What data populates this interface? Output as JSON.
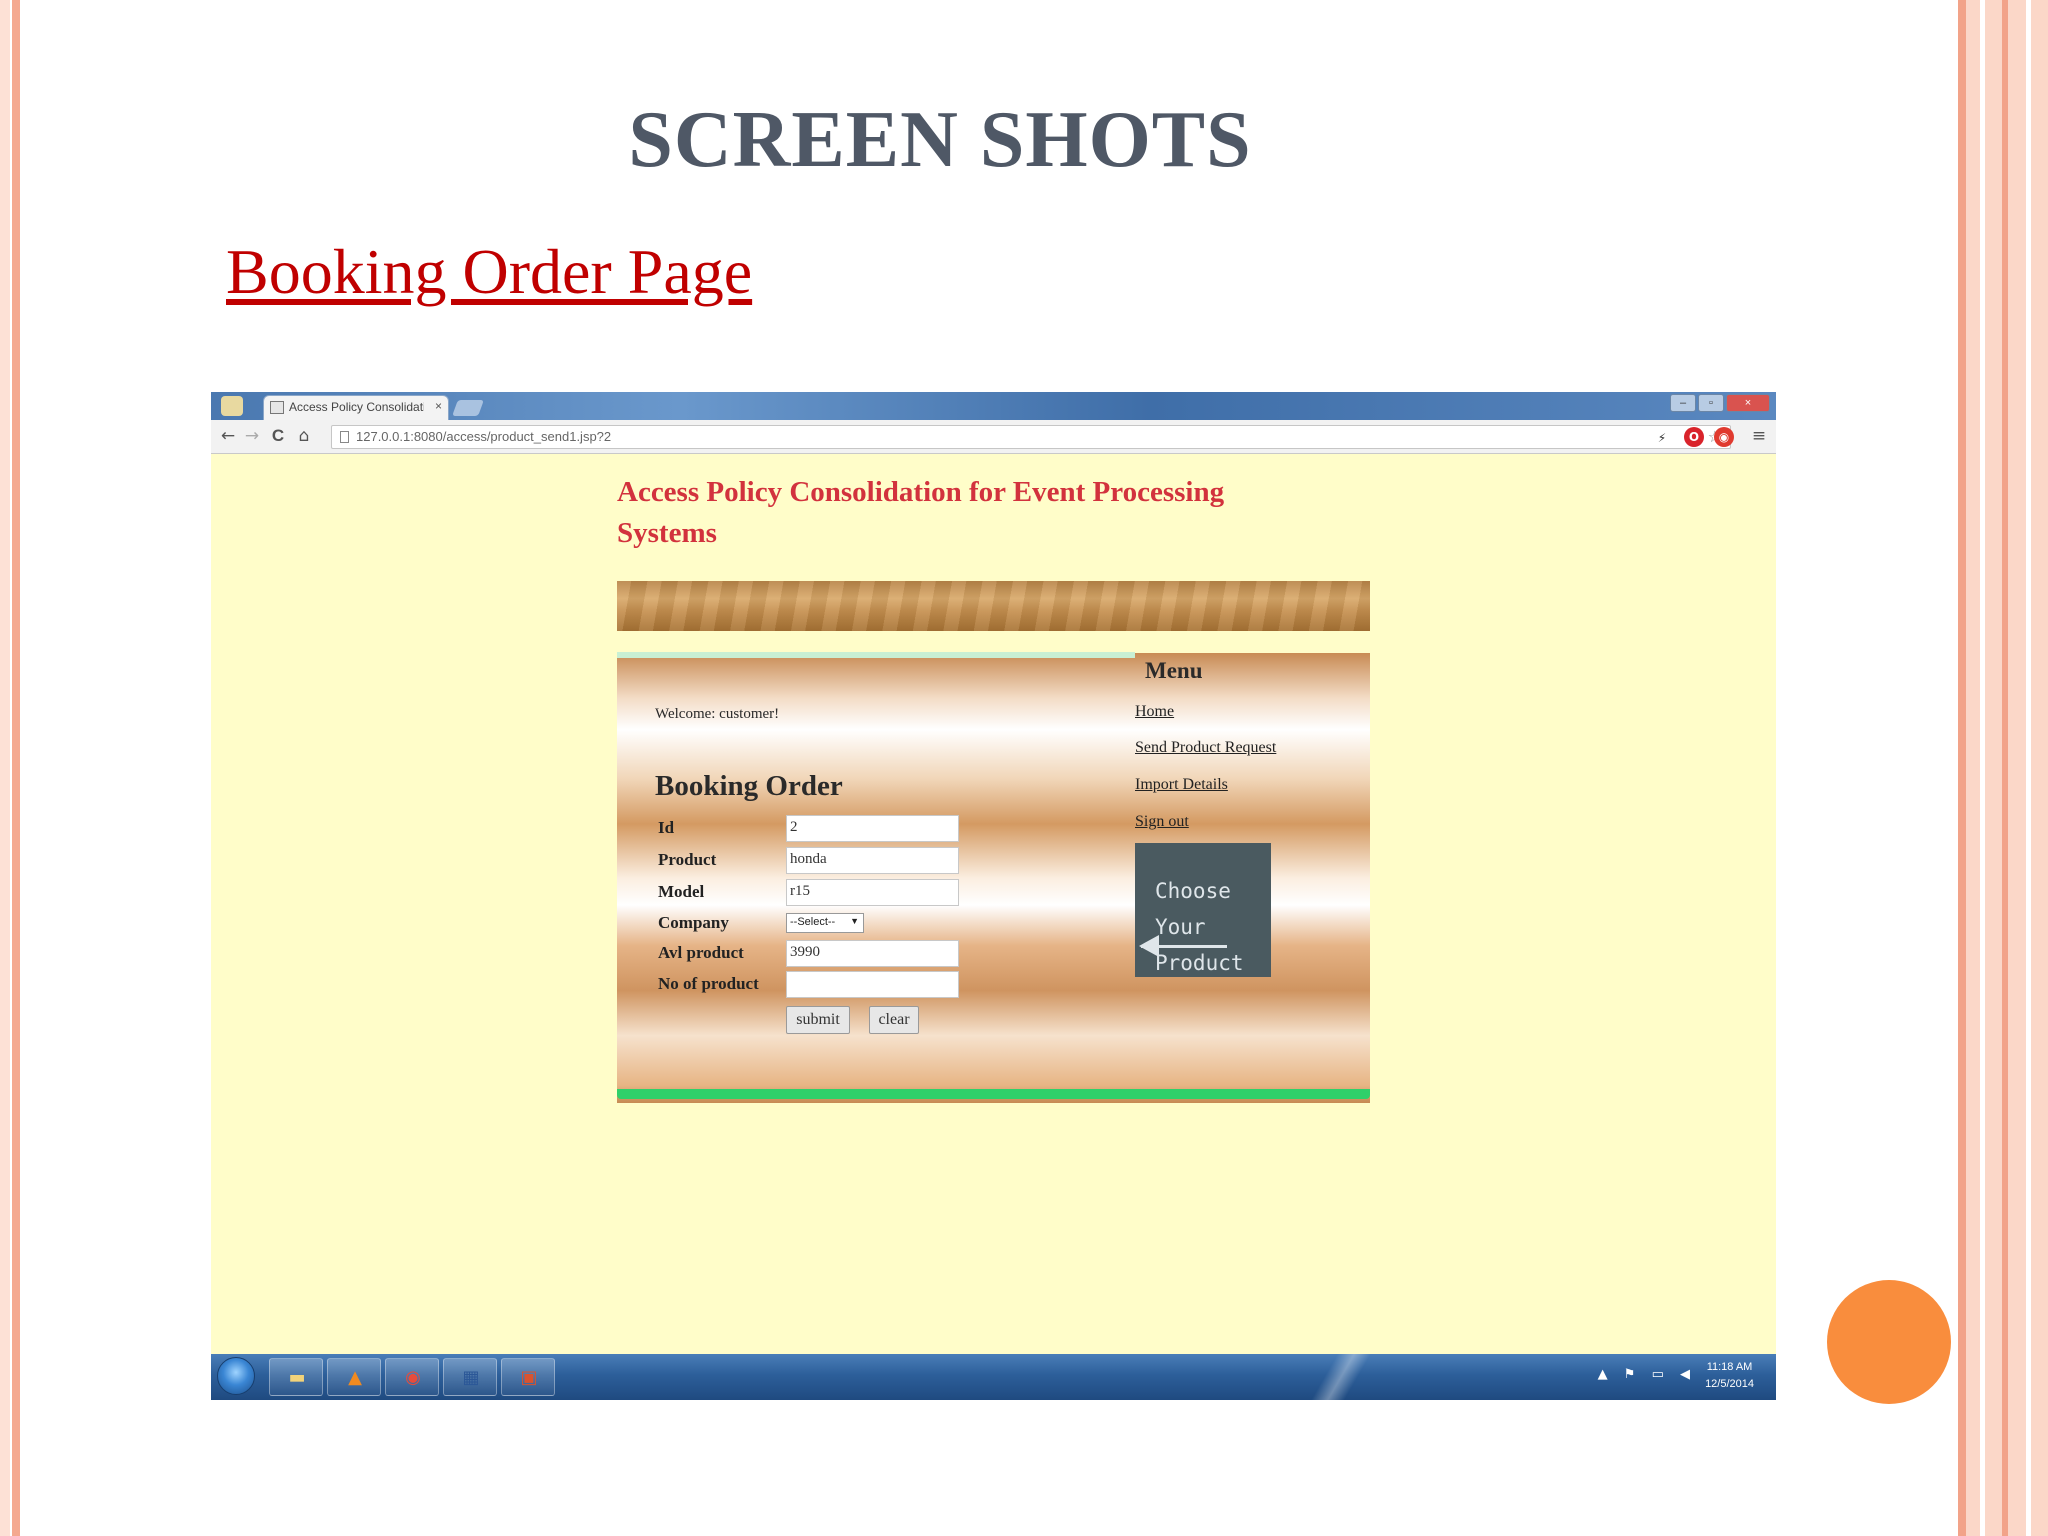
{
  "slide": {
    "title": "SCREEN SHOTS",
    "subtitle": "Booking Order Page"
  },
  "browser": {
    "tab_title": "Access Policy Consolidati",
    "tab_close": "×",
    "url": "127.0.0.1:8080/access/product_send1.jsp?2",
    "back_icon": "←",
    "forward_icon": "→",
    "reload_icon": "C",
    "home_icon": "⌂",
    "star_icon": "☆",
    "menu_icon": "≡"
  },
  "page": {
    "app_title": "Access Policy Consolidation for Event Processing Systems",
    "welcome": "Welcome: customer!",
    "form_title": "Booking Order",
    "fields": [
      {
        "label": "Id",
        "value": "2"
      },
      {
        "label": "Product",
        "value": "honda"
      },
      {
        "label": "Model",
        "value": "r15"
      },
      {
        "label": "Company",
        "value": "--Select--"
      },
      {
        "label": "Avl product",
        "value": "3990"
      },
      {
        "label": "No of product",
        "value": ""
      }
    ],
    "submit_label": "submit",
    "clear_label": "clear",
    "menu": {
      "title": "Menu",
      "items": [
        "Home",
        "Send Product Request",
        "Import Details",
        "Sign out"
      ]
    },
    "promo_text": "Choose Your Product"
  },
  "taskbar": {
    "time": "11:18 AM",
    "date": "12/5/2014",
    "tray_icons": "▲ ⚑ ▭ ◀"
  },
  "colors": {
    "title": "#4f5866",
    "subtitle": "#c00000",
    "app_title": "#d2323d",
    "page_bg": "#fffdc9",
    "accent_dot": "#f98d3d",
    "footer_bar": "#2fd06a"
  }
}
